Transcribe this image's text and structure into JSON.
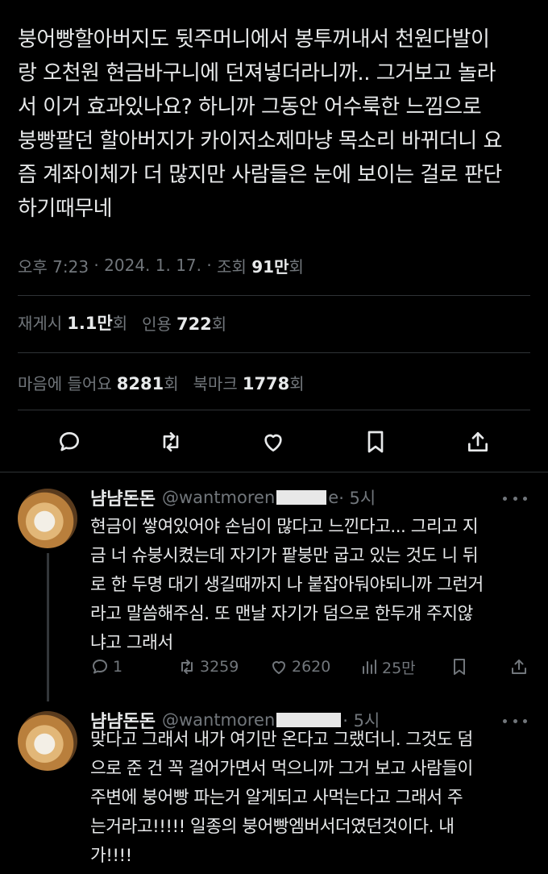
{
  "tweet": {
    "text": "붕어빵할아버지도 뒷주머니에서 봉투꺼내서 천원다발이\n랑 오천원 현금바구니에 던져넣더라니까.. 그거보고 놀라\n서 이거 효과있나요? 하니까 그동안 어수룩한 느낌으로\n붕빵팔던 할아버지가 카이저소제마냥 목소리 바뀌더니 요\n즘 계좌이체가 더 많지만 사람들은 눈에 보이는 걸로 판단\n하기때무네",
    "time": "오후 7:23",
    "date": "2024. 1. 17.",
    "views_label": "조회",
    "views_value": "91만",
    "views_suffix": "회"
  },
  "stats": {
    "retweets_label": "재게시",
    "retweets_value": "1.1만",
    "retweets_suffix": "회",
    "quotes_label": "인용",
    "quotes_value": "722",
    "quotes_suffix": "회",
    "likes_label": "마음에 들어요",
    "likes_value": "8281",
    "likes_suffix": "회",
    "bookmarks_label": "북마크",
    "bookmarks_value": "1778",
    "bookmarks_suffix": "회"
  },
  "actions": {
    "icons": [
      "reply-icon",
      "retweet-icon",
      "like-icon",
      "bookmark-icon",
      "share-icon"
    ]
  },
  "replies": [
    {
      "name": "냠냠돈돈",
      "handle": "@wantmoren",
      "handle_tail": "e",
      "time": "· 5시",
      "text": "현금이 쌓여있어야 손님이 많다고 느낀다고... 그리고 지\n금 너 슈붕시켰는데 자기가 팥붕만 굽고 있는 것도 니 뒤\n로 한 두명 대기 생길때까지 나 붙잡아둬야되니까 그런거\n라고 말씀해주심. 또 맨날 자기가 덤으로 한두개 주지않\n냐고 그래서",
      "replies": "1",
      "retweets": "3259",
      "likes": "2620",
      "views": "25만"
    },
    {
      "name": "냠냠돈돈",
      "handle": "@wantmoren",
      "handle_tail": "",
      "time": "· 5시",
      "text": "맞다고 그래서 내가 여기만 온다고 그랬더니. 그것도 덤\n으로 준 건 꼭 걸어가면서 먹으니까 그거 보고 사람들이\n주변에 붕어빵 파는거 알게되고 사먹는다고 그래서 주\n는거라고!!!!! 일종의 붕어빵엠버서더였던것이다. 내\n가!!!!"
    }
  ],
  "colors": {
    "background": "#000000",
    "text": "#e7e9ea",
    "muted": "#71767b",
    "divider": "#2f3336"
  }
}
